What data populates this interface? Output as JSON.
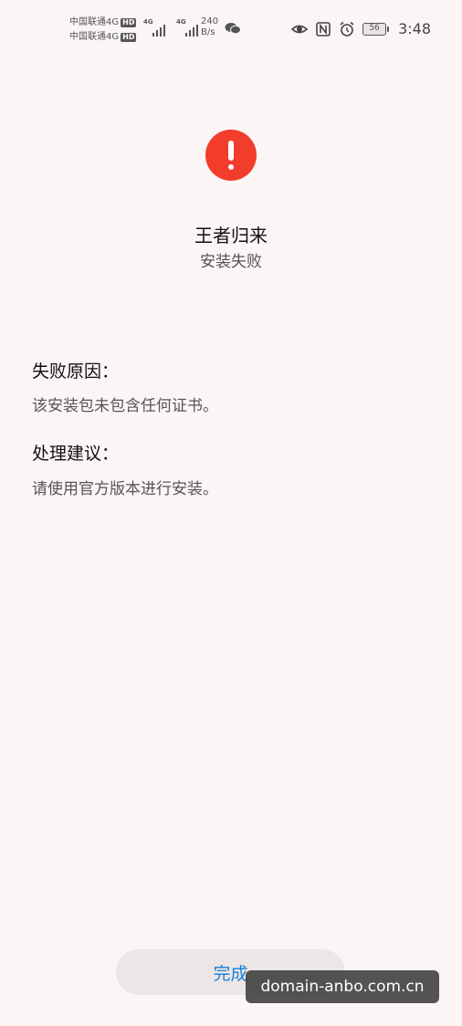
{
  "status_bar": {
    "carrier1": "中国联通4G",
    "carrier2": "中国联通4G",
    "hd_label": "HD",
    "signal1_label": "4G",
    "signal2_label": "4G",
    "net_speed_value": "240",
    "net_speed_unit": "B/s",
    "battery": "56",
    "time": "3:48"
  },
  "result": {
    "app_name": "王者归来",
    "status": "安装失败"
  },
  "details": {
    "reason_title": "失败原因：",
    "reason_text": "该安装包未包含任何证书。",
    "advice_title": "处理建议：",
    "advice_text": "请使用官方版本进行安装。"
  },
  "actions": {
    "done_label": "完成"
  },
  "watermark": "domain-anbo.com.cn",
  "colors": {
    "alert": "#f23d2c",
    "accent": "#1a7fd6",
    "background": "#fcf5f5"
  }
}
